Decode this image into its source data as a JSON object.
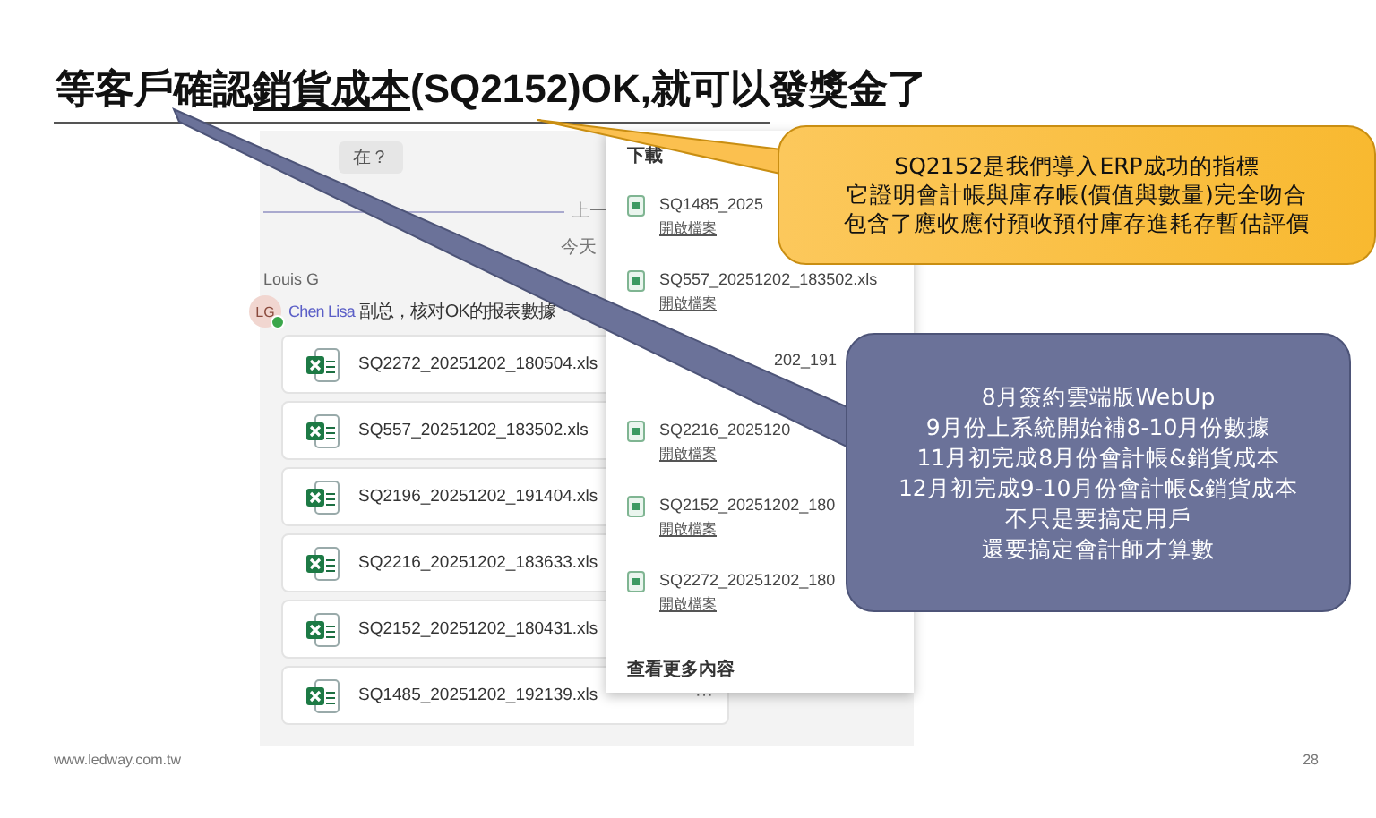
{
  "slide": {
    "title_parts": [
      {
        "text": "等客戶確認",
        "underline": false
      },
      {
        "text": "銷貨成本",
        "underline": true
      },
      {
        "text": "(SQ2152)OK,就可以發獎金了",
        "underline": false
      }
    ],
    "footer_url": "www.ledway.com.tw",
    "page_number": "28"
  },
  "chat": {
    "previous_message": "在？",
    "divider_label": "上一",
    "date_label": "今天",
    "sender": "Louis G",
    "avatar_initials": "LG",
    "online": true,
    "mention": "Chen Lisa",
    "message": "副总，核对OK的报表數據",
    "attachments": [
      {
        "name": "SQ2272_20251202_180504.xls"
      },
      {
        "name": "SQ557_20251202_183502.xls"
      },
      {
        "name": "SQ2196_20251202_191404.xls"
      },
      {
        "name": "SQ2216_20251202_183633.xls"
      },
      {
        "name": "SQ2152_20251202_180431.xls"
      },
      {
        "name": "SQ1485_20251202_192139.xls",
        "menu": "···"
      }
    ]
  },
  "downloads": {
    "title": "下載",
    "items": [
      {
        "name": "SQ1485_2025",
        "action": "開啟檔案"
      },
      {
        "name": "SQ557_20251202_183502.xls",
        "action": "開啟檔案"
      },
      {
        "name": "202_191"
      },
      {
        "name": "SQ2216_2025120",
        "action": "開啟檔案"
      },
      {
        "name": "SQ2152_20251202_180",
        "action": "開啟檔案"
      },
      {
        "name": "SQ2272_20251202_180",
        "action": "開啟檔案"
      }
    ],
    "see_more": "查看更多內容"
  },
  "callouts": [
    {
      "kind": "note",
      "lines": [
        "SQ2152是我們導入ERP成功的指標",
        "它證明會計帳與庫存帳(價值與數量)完全吻合",
        "包含了應收應付預收預付庫存進耗存暫估評價"
      ]
    },
    {
      "kind": "timeline",
      "lines": [
        "8月簽約雲端版WebUp",
        "9月份上系統開始補8-10月份數據",
        "11月初完成8月份會計帳&銷貨成本",
        "12月初完成9-10月份會計帳&銷貨成本",
        "不只是要搞定用戶",
        "還要搞定會計師才算數"
      ]
    }
  ]
}
